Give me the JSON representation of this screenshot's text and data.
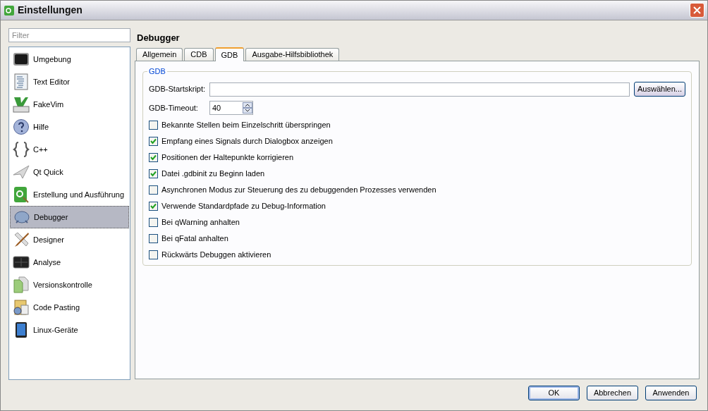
{
  "window": {
    "title": "Einstellungen"
  },
  "filter": {
    "placeholder": "Filter"
  },
  "sidebar": {
    "items": [
      {
        "label": "Umgebung",
        "selected": false
      },
      {
        "label": "Text Editor",
        "selected": false
      },
      {
        "label": "FakeVim",
        "selected": false
      },
      {
        "label": "Hilfe",
        "selected": false
      },
      {
        "label": "C++",
        "selected": false
      },
      {
        "label": "Qt Quick",
        "selected": false
      },
      {
        "label": "Erstellung und Ausführung",
        "selected": false
      },
      {
        "label": "Debugger",
        "selected": true
      },
      {
        "label": "Designer",
        "selected": false
      },
      {
        "label": "Analyse",
        "selected": false
      },
      {
        "label": "Versionskontrolle",
        "selected": false
      },
      {
        "label": "Code Pasting",
        "selected": false
      },
      {
        "label": "Linux-Geräte",
        "selected": false
      }
    ]
  },
  "page_title": "Debugger",
  "tabs": [
    {
      "label": "Allgemein",
      "selected": false
    },
    {
      "label": "CDB",
      "selected": false
    },
    {
      "label": "GDB",
      "selected": true
    },
    {
      "label": "Ausgabe-Hilfsbibliothek",
      "selected": false
    }
  ],
  "group": {
    "title": "GDB",
    "startscript": {
      "label": "GDB-Startskript:",
      "button": "Auswählen..."
    },
    "timeout": {
      "label": "GDB-Timeout:",
      "value": "40"
    },
    "options": [
      {
        "label": "Bekannte Stellen beim Einzelschritt überspringen",
        "checked": false
      },
      {
        "label": "Empfang eines Signals durch Dialogbox anzeigen",
        "checked": true
      },
      {
        "label": "Positionen der Haltepunkte korrigieren",
        "checked": true
      },
      {
        "label": "Datei .gdbinit zu Beginn laden",
        "checked": true
      },
      {
        "label": "Asynchronen Modus zur Steuerung des zu debuggenden Prozesses verwenden",
        "checked": false
      },
      {
        "label": "Verwende Standardpfade zu Debug-Information",
        "checked": true
      },
      {
        "label": "Bei qWarning anhalten",
        "checked": false
      },
      {
        "label": "Bei qFatal anhalten",
        "checked": false
      },
      {
        "label": "Rückwärts Debuggen aktivieren",
        "checked": false
      }
    ]
  },
  "buttons": [
    "OK",
    "Abbrechen",
    "Anwenden"
  ]
}
